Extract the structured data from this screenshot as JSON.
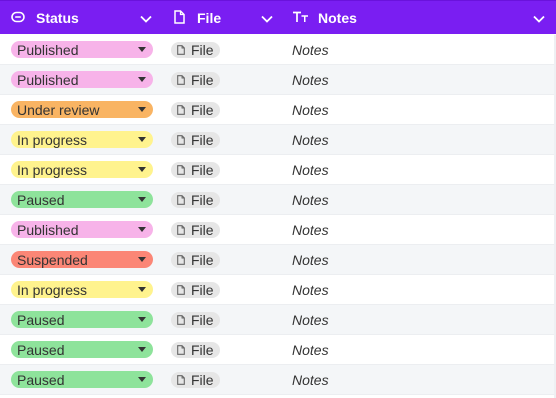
{
  "header": {
    "status_label": "Status",
    "file_label": "File",
    "notes_label": "Notes"
  },
  "status_colors": {
    "Published": "#f7b3e9",
    "Under review": "#f9b463",
    "In progress": "#fff38e",
    "Paused": "#8ee39b",
    "Suspended": "#fb8676"
  },
  "header_color": "#7a1ef2",
  "rows": [
    {
      "status": "Published",
      "file": "File",
      "notes": "Notes"
    },
    {
      "status": "Published",
      "file": "File",
      "notes": "Notes"
    },
    {
      "status": "Under review",
      "file": "File",
      "notes": "Notes"
    },
    {
      "status": "In progress",
      "file": "File",
      "notes": "Notes"
    },
    {
      "status": "In progress",
      "file": "File",
      "notes": "Notes"
    },
    {
      "status": "Paused",
      "file": "File",
      "notes": "Notes"
    },
    {
      "status": "Published",
      "file": "File",
      "notes": "Notes"
    },
    {
      "status": "Suspended",
      "file": "File",
      "notes": "Notes"
    },
    {
      "status": "In progress",
      "file": "File",
      "notes": "Notes"
    },
    {
      "status": "Paused",
      "file": "File",
      "notes": "Notes"
    },
    {
      "status": "Paused",
      "file": "File",
      "notes": "Notes"
    },
    {
      "status": "Paused",
      "file": "File",
      "notes": "Notes"
    }
  ]
}
